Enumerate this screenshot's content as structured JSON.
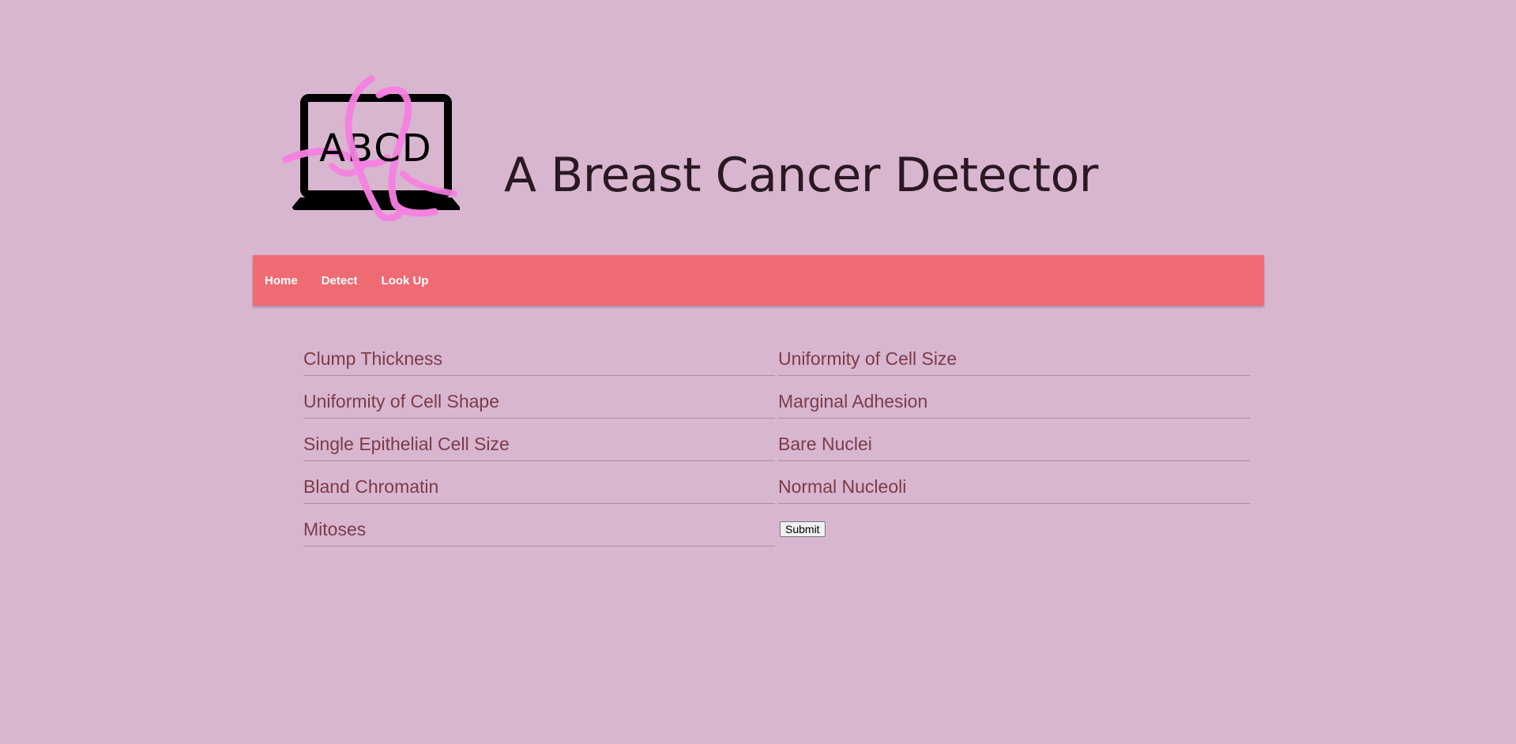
{
  "header": {
    "logo_text": "ABCD",
    "title": "A Breast Cancer Detector"
  },
  "nav": {
    "items": [
      {
        "label": "Home"
      },
      {
        "label": "Detect"
      },
      {
        "label": "Look Up"
      }
    ]
  },
  "form": {
    "fields": [
      {
        "placeholder": "Clump Thickness",
        "value": ""
      },
      {
        "placeholder": "Uniformity of Cell Size",
        "value": ""
      },
      {
        "placeholder": "Uniformity of Cell Shape",
        "value": ""
      },
      {
        "placeholder": "Marginal Adhesion",
        "value": ""
      },
      {
        "placeholder": "Single Epithelial Cell Size",
        "value": ""
      },
      {
        "placeholder": "Bare Nuclei",
        "value": ""
      },
      {
        "placeholder": "Bland Chromatin",
        "value": ""
      },
      {
        "placeholder": "Normal Nucleoli",
        "value": ""
      },
      {
        "placeholder": "Mitoses",
        "value": ""
      }
    ],
    "submit_label": "Submit"
  },
  "colors": {
    "background": "#d9b6d0",
    "navbar": "#ef6b74",
    "nav_text": "#ffffff",
    "field_text": "#7a3c48",
    "ribbon": "#f67fe0"
  },
  "icons": {
    "logo": "laptop-with-pink-ribbon-icon"
  }
}
